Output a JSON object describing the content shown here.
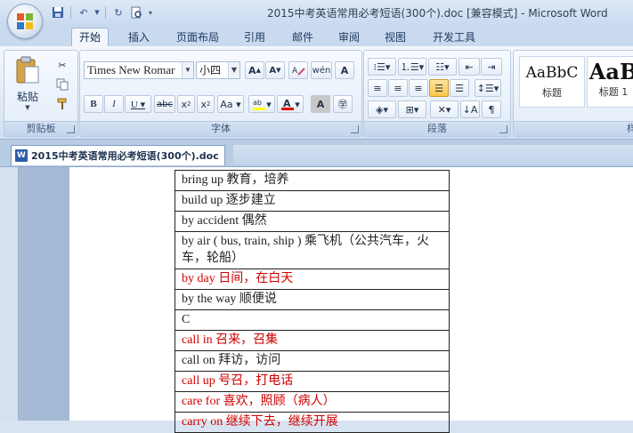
{
  "window": {
    "title": "2015中考英语常用必考短语(300个).doc [兼容模式] - Microsoft Word"
  },
  "ribbon": {
    "tabs": [
      "开始",
      "插入",
      "页面布局",
      "引用",
      "邮件",
      "审阅",
      "视图",
      "开发工具"
    ],
    "active_tab": "开始",
    "clipboard": {
      "paste_label": "粘贴",
      "group_label": "剪贴板"
    },
    "font": {
      "font_name": "Times New Romar",
      "font_size": "小四",
      "group_label": "字体",
      "highlight_color": "#ffff00",
      "font_color": "#e00000"
    },
    "paragraph": {
      "group_label": "段落"
    },
    "styles": [
      {
        "sample": "AaBbC",
        "name": "标题"
      },
      {
        "sample": "AaB",
        "name": "标题 1"
      }
    ]
  },
  "document": {
    "tab_label": "2015中考英语常用必考短语(300个).doc",
    "rows": [
      {
        "text": "bring up  教育，培养",
        "red": false
      },
      {
        "text": "build up  逐步建立",
        "red": false
      },
      {
        "text": "by accident  偶然",
        "red": false
      },
      {
        "text": "by air ( bus, train, ship ) 乘飞机（公共汽车，火车，轮船）",
        "red": false
      },
      {
        "text": "by day  日间，在白天",
        "red": true
      },
      {
        "text": "by the way  顺便说",
        "red": false
      },
      {
        "text": "C",
        "red": false
      },
      {
        "text": "call in  召来，召集",
        "red": true
      },
      {
        "text": "call on  拜访，访问",
        "red": false
      },
      {
        "text": "call up 号召，打电话",
        "red": true
      },
      {
        "text": "care for 喜欢，照顾（病人）",
        "red": true
      },
      {
        "text": "carry on  继续下去，继续开展",
        "red": true
      }
    ]
  },
  "colors": {
    "red_text": "#d00000",
    "ribbon_bg": "#dde8f5",
    "workspace_bg": "#a5bad5"
  }
}
